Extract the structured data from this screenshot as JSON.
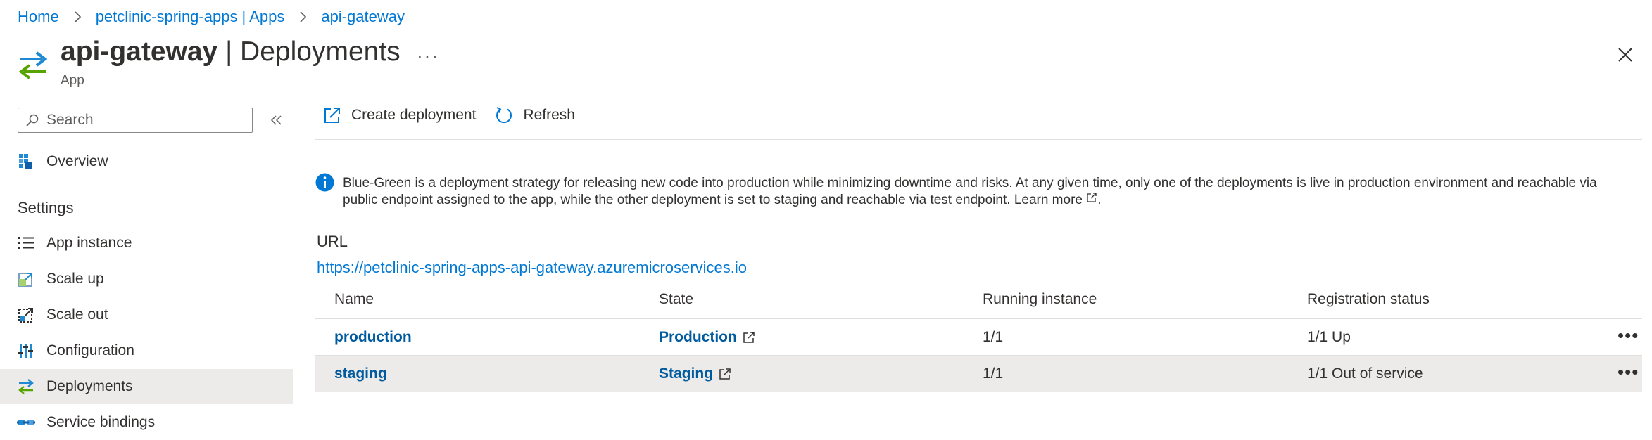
{
  "breadcrumb": [
    {
      "label": "Home"
    },
    {
      "label": "petclinic-spring-apps | Apps"
    },
    {
      "label": "api-gateway"
    }
  ],
  "header": {
    "title_bold": "api-gateway",
    "title_rest": " | Deployments",
    "subtitle": "App",
    "more": "···"
  },
  "sidebar": {
    "search_placeholder": "Search",
    "overview": "Overview",
    "settings_heading": "Settings",
    "items": [
      {
        "label": "App instance",
        "icon": "list-icon"
      },
      {
        "label": "Scale up",
        "icon": "scale-up-icon"
      },
      {
        "label": "Scale out",
        "icon": "scale-out-icon"
      },
      {
        "label": "Configuration",
        "icon": "configuration-icon"
      },
      {
        "label": "Deployments",
        "icon": "deployments-icon",
        "selected": true
      },
      {
        "label": "Service bindings",
        "icon": "service-bindings-icon"
      }
    ]
  },
  "toolbar": {
    "create_label": "Create deployment",
    "refresh_label": "Refresh"
  },
  "info": {
    "text": "Blue-Green is a deployment strategy for releasing new code into production while minimizing downtime and risks. At any given time, only one of the deployments is live in production environment and reachable via public endpoint assigned to the app, while the other deployment is set to staging and reachable via test endpoint.",
    "learn_more": "Learn more",
    "end": "."
  },
  "url": {
    "label": "URL",
    "value": "https://petclinic-spring-apps-api-gateway.azuremicroservices.io"
  },
  "table": {
    "headers": [
      "Name",
      "State",
      "Running instance",
      "Registration status"
    ],
    "rows": [
      {
        "name": "production",
        "state": "Production",
        "running": "1/1",
        "registration": "1/1 Up",
        "more": "•••"
      },
      {
        "name": "staging",
        "state": "Staging",
        "running": "1/1",
        "registration": "1/1 Out of service",
        "more": "•••"
      }
    ]
  },
  "colors": {
    "accent": "#0078d4",
    "selected_bg": "#edebe9",
    "link_dark": "#005a9e"
  }
}
